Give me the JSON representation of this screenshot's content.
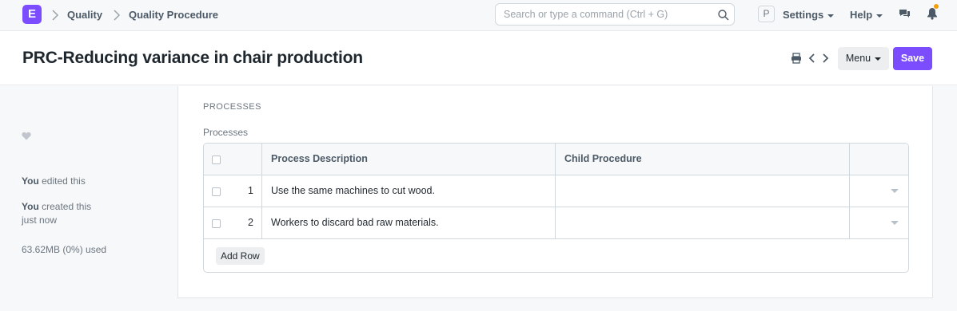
{
  "navbar": {
    "logo_letter": "E",
    "breadcrumbs": [
      "Quality",
      "Quality Procedure"
    ],
    "search_placeholder": "Search or type a command (Ctrl + G)",
    "avatar_letter": "P",
    "settings_label": "Settings",
    "help_label": "Help"
  },
  "page": {
    "title": "PRC-Reducing variance in chair production",
    "menu_label": "Menu",
    "save_label": "Save"
  },
  "sidebar": {
    "edited_actor": "You",
    "edited_text": " edited this",
    "created_actor": "You",
    "created_text": " created this",
    "created_time": "just now",
    "storage": "63.62MB (0%) used"
  },
  "form": {
    "section_title": "PROCESSES",
    "field_label": "Processes",
    "columns": [
      "Process Description",
      "Child Procedure"
    ],
    "rows": [
      {
        "idx": "1",
        "description": "Use the same machines to cut wood.",
        "child": ""
      },
      {
        "idx": "2",
        "description": "Workers to discard bad raw materials.",
        "child": ""
      }
    ],
    "add_row_label": "Add Row"
  },
  "colors": {
    "accent": "#7c4dff",
    "notification": "#f59e0b"
  }
}
